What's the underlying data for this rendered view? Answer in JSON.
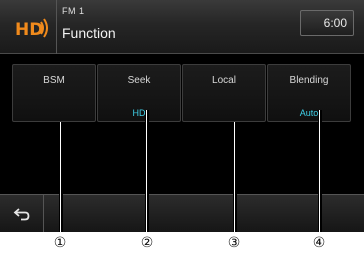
{
  "header": {
    "band": "FM 1",
    "title": "Function",
    "clock": "6:00"
  },
  "buttons": [
    {
      "label": "BSM",
      "value": ""
    },
    {
      "label": "Seek",
      "value": "HD"
    },
    {
      "label": "Local",
      "value": ""
    },
    {
      "label": "Blending",
      "value": "Auto"
    }
  ],
  "callouts": [
    "①",
    "②",
    "③",
    "④"
  ],
  "colors": {
    "accent": "#3fd0e8",
    "logo_orange": "#f08a1c"
  },
  "icons": {
    "logo": "hd-radio-logo-icon",
    "back": "back-arrow-icon"
  }
}
